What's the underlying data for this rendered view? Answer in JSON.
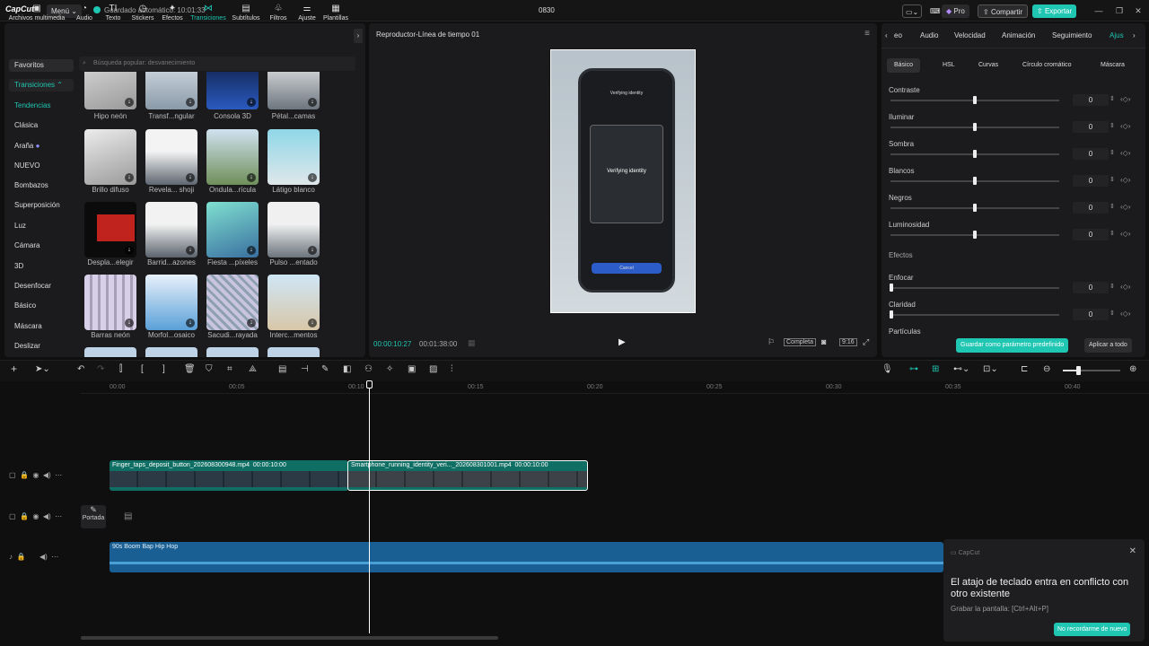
{
  "app": {
    "logo": "CapCut",
    "menu_label": "Menú",
    "saved_text": "Guardado automático: 10:01:33",
    "project_title": "0830",
    "pro_label": "Pro",
    "share_label": "Compartir",
    "export_label": "Exportar"
  },
  "left_tools": [
    {
      "label": "Archivos multimedia",
      "icon": "media-icon"
    },
    {
      "label": "Audio",
      "icon": "audio-icon"
    },
    {
      "label": "Texto",
      "icon": "text-icon"
    },
    {
      "label": "Stickers",
      "icon": "sticker-icon"
    },
    {
      "label": "Efectos",
      "icon": "effects-icon"
    },
    {
      "label": "Transiciones",
      "icon": "transitions-icon"
    },
    {
      "label": "Subtítulos",
      "icon": "subtitles-icon"
    },
    {
      "label": "Filtros",
      "icon": "filters-icon"
    },
    {
      "label": "Ajuste",
      "icon": "adjust-icon"
    },
    {
      "label": "Plantillas",
      "icon": "templates-icon"
    }
  ],
  "categories": [
    "Favoritos",
    "Transiciones",
    "Tendencias",
    "Clásica",
    "Araña",
    "NUEVO",
    "Bombazos",
    "Superposición",
    "Luz",
    "Cámara",
    "3D",
    "Desenfocar",
    "Básico",
    "Máscara",
    "Deslizar"
  ],
  "search_placeholder": "Búsqueda popular: desvanecimiento",
  "transitions": [
    [
      "Hipo neón",
      "Transf...ngular",
      "Consola 3D",
      "Pétal...camas"
    ],
    [
      "Brillo difuso",
      "Revela... shoji",
      "Ondula...rícula",
      "Látigo blanco"
    ],
    [
      "Despla...elegir",
      "Barrid...azones",
      "Fiesta ...píxeles",
      "Pulso ...entado"
    ],
    [
      "Barras neón",
      "Morfol...osaico",
      "Sacudi...rayada",
      "Interc...mentos"
    ]
  ],
  "preview": {
    "title": "Reproductor-Línea de tiempo 01",
    "current_time": "00:00:10:27",
    "total_time": "00:01:38:00",
    "full_label": "Completa",
    "ratio_label": "9:16",
    "phone_header": "Verifying identity",
    "phone_scan": "Verifying identity",
    "phone_cancel": "Cancel"
  },
  "right_tabs": [
    "eo",
    "Audio",
    "Velocidad",
    "Animación",
    "Seguimiento",
    "Ajus"
  ],
  "sub_tabs": [
    "Básico",
    "HSL",
    "Curvas",
    "Círculo cromático",
    "Máscara"
  ],
  "adjustments": [
    {
      "label": "Contraste",
      "value": "0"
    },
    {
      "label": "Iluminar",
      "value": "0"
    },
    {
      "label": "Sombra",
      "value": "0"
    },
    {
      "label": "Blancos",
      "value": "0"
    },
    {
      "label": "Negros",
      "value": "0"
    },
    {
      "label": "Luminosidad",
      "value": "0"
    }
  ],
  "effects_heading": "Efectos",
  "effects": [
    {
      "label": "Enfocar",
      "value": "0"
    },
    {
      "label": "Claridad",
      "value": "0"
    }
  ],
  "particles_label": "Partículas",
  "save_preset_label": "Guardar como parámetro predefinido",
  "apply_all_label": "Aplicar a todo",
  "ruler": [
    "00:00",
    "00:05",
    "00:10",
    "00:15",
    "00:20",
    "00:25",
    "00:30",
    "00:35",
    "00:40"
  ],
  "clips": {
    "clip1_name": "Finger_taps_deposit_button_202608300948.mp4",
    "clip1_dur": "00:00:10:00",
    "clip2_name": "Smartphone_running_identity_veri..._202608301001.mp4",
    "clip2_dur": "00:00:10:00",
    "audio_name": "90s Boom Bap Hip Hop",
    "cover_label": "Portada"
  },
  "toast": {
    "brand": "CapCut",
    "title": "El atajo de teclado entra en conflicto con otro existente",
    "subtitle": "Grabar la pantalla: [Ctrl+Alt+P]",
    "button": "No recordarme de nuevo"
  },
  "colors": {
    "accent": "#1fc6b2",
    "clip": "#0f6f64",
    "audio": "#1a5f93"
  }
}
